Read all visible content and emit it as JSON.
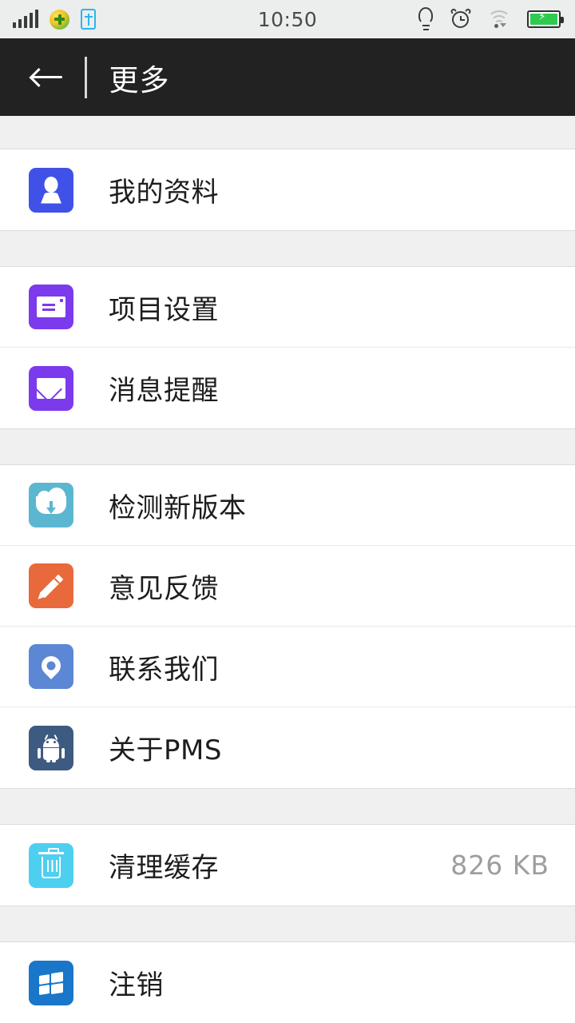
{
  "status_bar": {
    "clock": "10:50",
    "signal_icon": "signal-bars-icon",
    "security_icon": "security-shield-icon",
    "usb_icon": "usb-icon",
    "flashlight_icon": "lightbulb-icon",
    "alarm_icon": "alarm-clock-icon",
    "wifi_icon": "wifi-icon",
    "battery_icon": "battery-charging-icon"
  },
  "header": {
    "back_icon": "back-arrow-icon",
    "title": "更多"
  },
  "colors": {
    "header_bg": "#222222",
    "status_bg": "#eceded",
    "page_bg": "#ffffff",
    "separator": "#f0f0f0",
    "value_text": "#9e9e9e",
    "profile": "#4051e8",
    "project_settings": "#7c3aed",
    "message_alerts": "#7c3aed",
    "check_version": "#5bb7d0",
    "feedback": "#e8693b",
    "contact_us": "#5b87d4",
    "about": "#3d5a80",
    "clear_cache": "#4dd0f0",
    "logout": "#1976c9"
  },
  "sections": [
    {
      "rows": [
        {
          "label": "我的资料",
          "icon": "person-icon",
          "value": ""
        }
      ]
    },
    {
      "rows": [
        {
          "label": "项目设置",
          "icon": "card-settings-icon",
          "value": ""
        },
        {
          "label": "消息提醒",
          "icon": "envelope-icon",
          "value": ""
        }
      ]
    },
    {
      "rows": [
        {
          "label": "检测新版本",
          "icon": "cloud-download-icon",
          "value": ""
        },
        {
          "label": "意见反馈",
          "icon": "pencil-icon",
          "value": ""
        },
        {
          "label": "联系我们",
          "icon": "location-pin-icon",
          "value": ""
        },
        {
          "label": "关于PMS",
          "icon": "android-robot-icon",
          "value": ""
        }
      ]
    },
    {
      "rows": [
        {
          "label": "清理缓存",
          "icon": "trash-icon",
          "value": "826 KB"
        }
      ]
    },
    {
      "rows": [
        {
          "label": "注销",
          "icon": "windows-flag-icon",
          "value": ""
        }
      ]
    }
  ]
}
